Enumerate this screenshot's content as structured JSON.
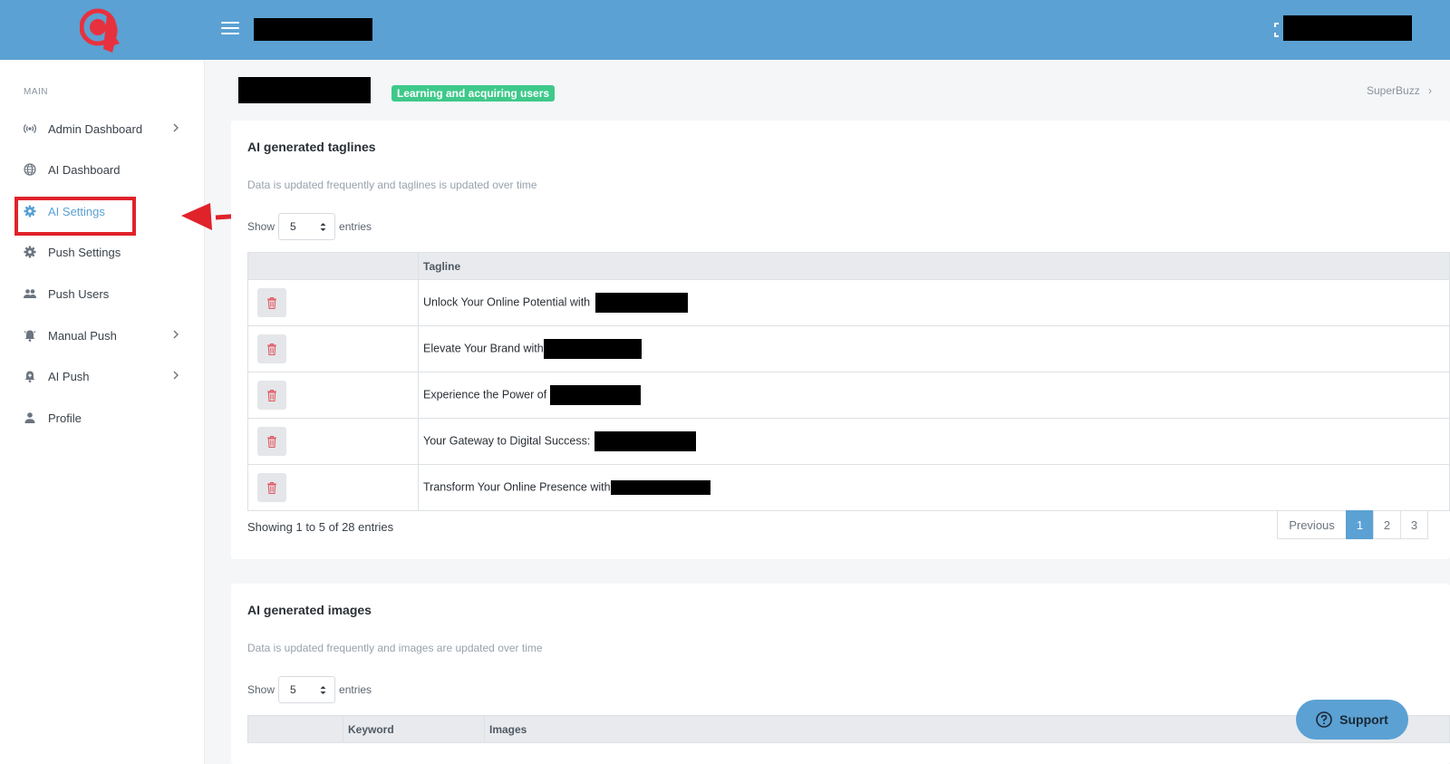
{
  "sidebar": {
    "section_title": "MAIN",
    "items": [
      {
        "label": "Admin Dashboard",
        "icon": "broadcast-icon"
      },
      {
        "label": "AI Dashboard",
        "icon": "globe-icon"
      },
      {
        "label": "AI Settings",
        "icon": "gear-icon"
      },
      {
        "label": "Push Settings",
        "icon": "gear-icon"
      },
      {
        "label": "Push Users",
        "icon": "users-icon"
      },
      {
        "label": "Manual Push",
        "icon": "bell-ring-icon"
      },
      {
        "label": "AI Push",
        "icon": "bell-plus-icon"
      },
      {
        "label": "Profile",
        "icon": "person-icon"
      }
    ]
  },
  "header": {
    "status_badge": "Learning and acquiring users",
    "breadcrumb": "SuperBuzz"
  },
  "taglines": {
    "title": "AI generated taglines",
    "subtitle": "Data is updated frequently and taglines is updated over time",
    "show_label": "Show",
    "entries_label": "entries",
    "page_size": "5",
    "columns": [
      "",
      "Tagline"
    ],
    "rows": [
      "Unlock Your Online Potential with",
      "Elevate Your Brand with",
      "Experience the Power of",
      "Your Gateway to Digital Success:",
      "Transform Your Online Presence with"
    ],
    "info": "Showing 1 to 5 of 28 entries",
    "pagination": {
      "previous": "Previous",
      "pages": [
        "1",
        "2",
        "3"
      ],
      "current": "1"
    }
  },
  "images": {
    "title": "AI generated images",
    "subtitle": "Data is updated frequently and images are updated over time",
    "show_label": "Show",
    "entries_label": "entries",
    "page_size": "5",
    "columns": [
      "",
      "Keyword",
      "Images"
    ]
  },
  "support": {
    "label": "Support"
  },
  "colors": {
    "accent": "#5ba1d3",
    "badge": "#3ec98a",
    "annotation": "#e0222a",
    "trash": "#e05b66"
  }
}
